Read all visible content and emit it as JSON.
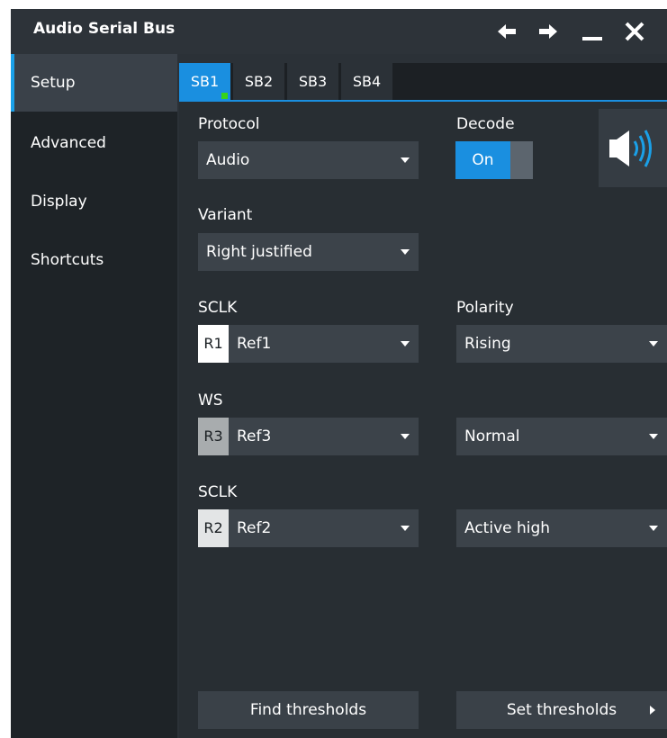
{
  "window": {
    "title": "Audio Serial Bus",
    "controls": [
      "arrow-left-icon",
      "arrow-right-icon",
      "minimize-icon",
      "close-icon"
    ]
  },
  "sidebar": {
    "items": [
      {
        "label": "Setup",
        "active": true
      },
      {
        "label": "Advanced",
        "active": false
      },
      {
        "label": "Display",
        "active": false
      },
      {
        "label": "Shortcuts",
        "active": false
      }
    ]
  },
  "tabs": [
    {
      "label": "SB1",
      "active": true
    },
    {
      "label": "SB2",
      "active": false
    },
    {
      "label": "SB3",
      "active": false
    },
    {
      "label": "SB4",
      "active": false
    }
  ],
  "protocol": {
    "label": "Protocol",
    "value": "Audio"
  },
  "decode": {
    "label": "Decode",
    "state": "On"
  },
  "variant": {
    "label": "Variant",
    "value": "Right justified"
  },
  "sclk": {
    "label": "SCLK",
    "badge": "R1",
    "value": "Ref1"
  },
  "polarity": {
    "label": "Polarity",
    "value": "Rising"
  },
  "ws": {
    "label": "WS",
    "badge": "R3",
    "value": "Ref3",
    "option": "Normal"
  },
  "sclk2": {
    "label": "SCLK",
    "badge": "R2",
    "value": "Ref2",
    "option": "Active high"
  },
  "buttons": {
    "find_thresholds": "Find thresholds",
    "set_thresholds": "Set thresholds"
  },
  "colors": {
    "accent": "#1a8fe0",
    "indicator": "#37d41a",
    "background": "#2b3137"
  }
}
